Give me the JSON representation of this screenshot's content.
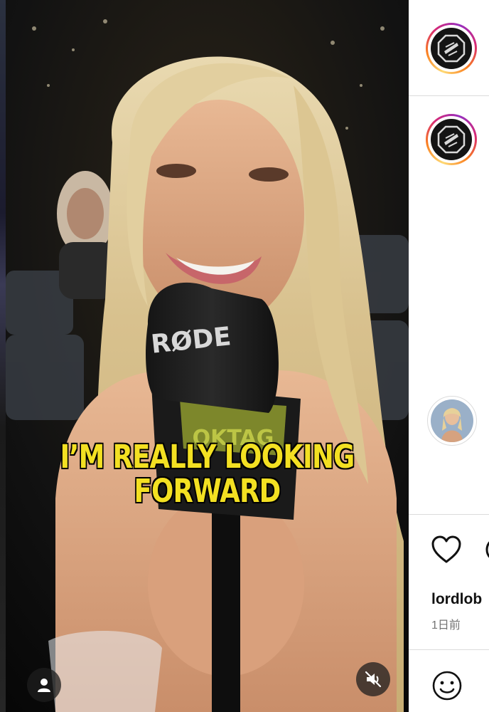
{
  "video": {
    "caption_line1": "I’M REALLY LOOKING",
    "caption_line2": "FORWARD",
    "mic_brand": "RØDE",
    "flag_text": "OKTAG"
  },
  "post": {
    "username": "lordlob",
    "time_ago": "1日前"
  },
  "icons": {
    "user": "user-icon",
    "mute": "speaker-muted-icon",
    "like": "heart-icon",
    "comment": "comment-icon",
    "emoji": "smiley-icon"
  },
  "colors": {
    "caption": "#f3e022",
    "story_ring": "#d62976",
    "divider": "#dbdbdb",
    "secondary_text": "#737373"
  }
}
